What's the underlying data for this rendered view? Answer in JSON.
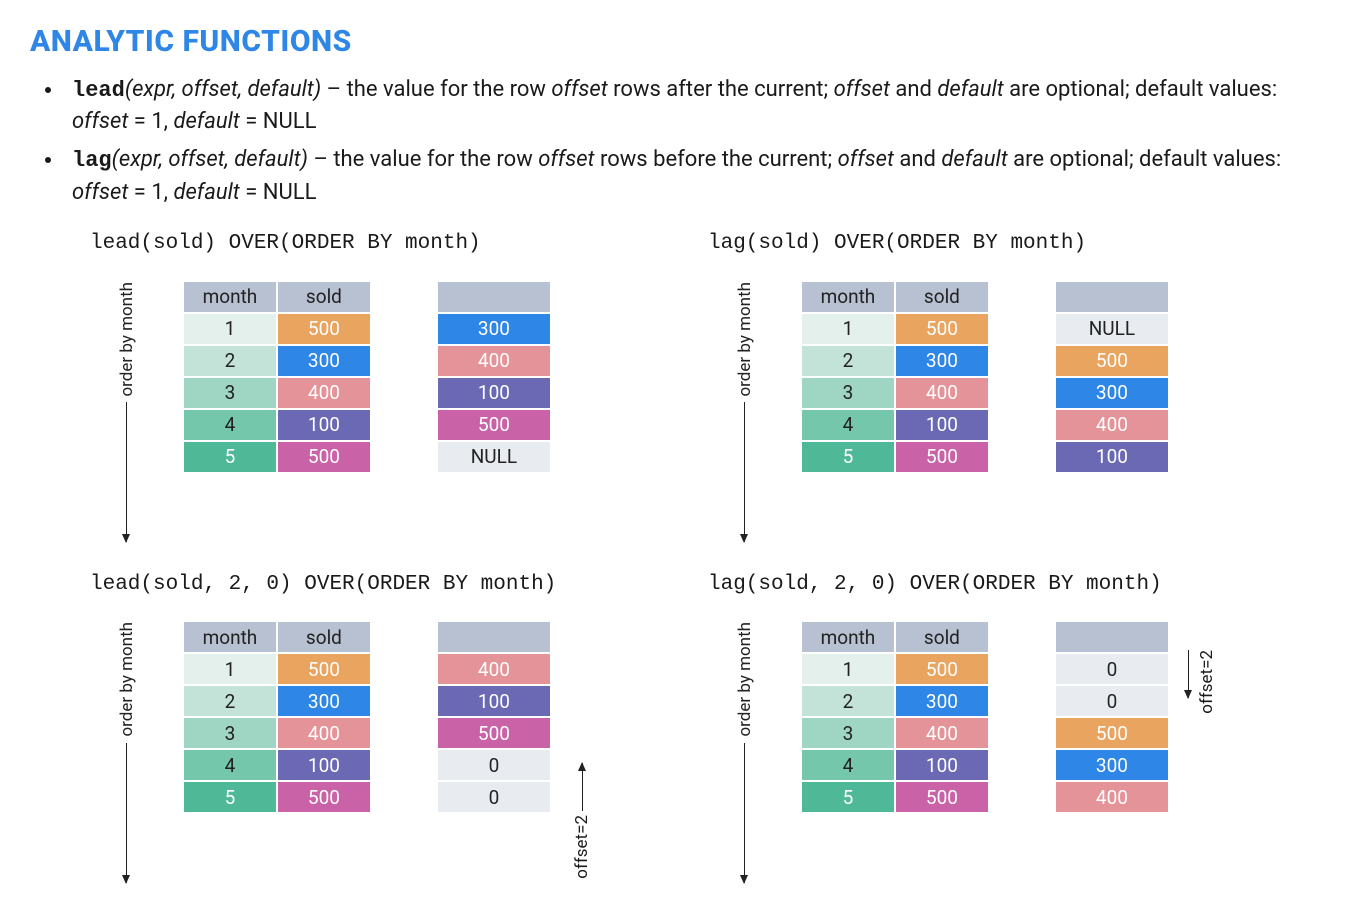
{
  "heading": "ANALYTIC FUNCTIONS",
  "defs": {
    "lead": {
      "fn": "lead",
      "args": "(expr, offset, default)",
      "dash": " – ",
      "t1": "the value for the row ",
      "offset1": "offset",
      "t2": " rows after the current; ",
      "offset2": "offset",
      "and": " and ",
      "default1": "default",
      "t3": " are optional; default values: ",
      "offset3": "offset",
      "eq1": " = 1, ",
      "default2": "default",
      "eq2": " = NULL"
    },
    "lag": {
      "fn": "lag",
      "args": "(expr, offset, default)",
      "dash": " – ",
      "t1": "the value for the row ",
      "offset1": "offset",
      "t2": " rows before the current; ",
      "offset2": "offset",
      "and": " and ",
      "default1": "default",
      "t3": " are optional; default values: ",
      "offset3": "offset",
      "eq1": " = 1, ",
      "default2": "default",
      "eq2": " = NULL"
    }
  },
  "axis_label": "order by month",
  "offset_label": "offset=2",
  "headers": {
    "month": "month",
    "sold": "sold",
    "blank": ""
  },
  "source_rows": [
    {
      "month": "1",
      "sold": "500",
      "sold_cls": "c-orange",
      "m_cls": "g1"
    },
    {
      "month": "2",
      "sold": "300",
      "sold_cls": "c-blue",
      "m_cls": "g2"
    },
    {
      "month": "3",
      "sold": "400",
      "sold_cls": "c-pink",
      "m_cls": "g3"
    },
    {
      "month": "4",
      "sold": "100",
      "sold_cls": "c-purple",
      "m_cls": "g4"
    },
    {
      "month": "5",
      "sold": "500",
      "sold_cls": "c-magenta",
      "m_cls": "g5"
    }
  ],
  "examples": [
    {
      "title": "lead(sold) OVER(ORDER BY month)",
      "result": [
        {
          "v": "300",
          "cls": "c-blue"
        },
        {
          "v": "400",
          "cls": "c-pink"
        },
        {
          "v": "100",
          "cls": "c-purple"
        },
        {
          "v": "500",
          "cls": "c-magenta"
        },
        {
          "v": "NULL",
          "cls": "c-grey"
        }
      ],
      "offset_annot": null
    },
    {
      "title": "lag(sold) OVER(ORDER BY month)",
      "result": [
        {
          "v": "NULL",
          "cls": "c-grey"
        },
        {
          "v": "500",
          "cls": "c-orange"
        },
        {
          "v": "300",
          "cls": "c-blue"
        },
        {
          "v": "400",
          "cls": "c-pink"
        },
        {
          "v": "100",
          "cls": "c-purple"
        }
      ],
      "offset_annot": null
    },
    {
      "title": "lead(sold, 2, 0) OVER(ORDER BY month)",
      "result": [
        {
          "v": "400",
          "cls": "c-pink"
        },
        {
          "v": "100",
          "cls": "c-purple"
        },
        {
          "v": "500",
          "cls": "c-magenta"
        },
        {
          "v": "0",
          "cls": "c-grey"
        },
        {
          "v": "0",
          "cls": "c-grey"
        }
      ],
      "offset_annot": {
        "dir": "up",
        "pos": "bottom"
      }
    },
    {
      "title": "lag(sold, 2, 0) OVER(ORDER BY month)",
      "result": [
        {
          "v": "0",
          "cls": "c-grey"
        },
        {
          "v": "0",
          "cls": "c-grey"
        },
        {
          "v": "500",
          "cls": "c-orange"
        },
        {
          "v": "300",
          "cls": "c-blue"
        },
        {
          "v": "400",
          "cls": "c-pink"
        }
      ],
      "offset_annot": {
        "dir": "down",
        "pos": "top"
      }
    }
  ]
}
